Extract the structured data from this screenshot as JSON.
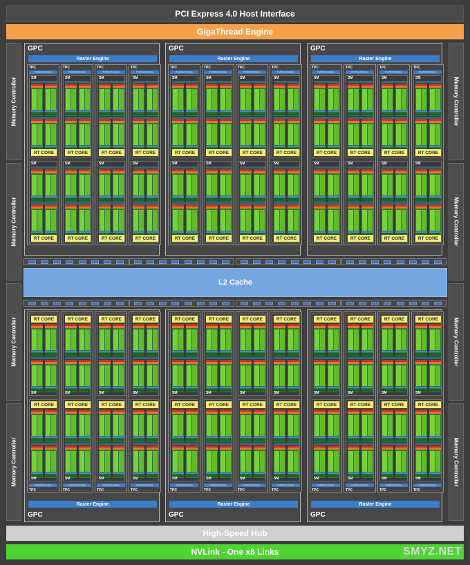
{
  "header": {
    "pci_label": "PCI Express 4.0 Host Interface",
    "gigathread_label": "GigaThread Engine"
  },
  "footer": {
    "hub_label": "High-Speed Hub",
    "nvlink_label": "NVLink - One x8 Links",
    "watermark": "SMYZ.NET"
  },
  "memory_controller_label": "Memory Controller",
  "l2_label": "L2 Cache",
  "gpc": {
    "label": "GPC",
    "raster_label": "Raster Engine",
    "tpc_label": "TPC",
    "polymorph_label": "PolyMorph Engine",
    "sm_label": "SM",
    "rt_core_label": "RT CORE"
  },
  "colors": {
    "gigathread": "#f6a14a",
    "nvlink": "#4ed433",
    "hub": "#cfcfcf",
    "l2": "#74a7e2",
    "raster": "#3c7cc8",
    "rt_core": "#f4ee73"
  }
}
